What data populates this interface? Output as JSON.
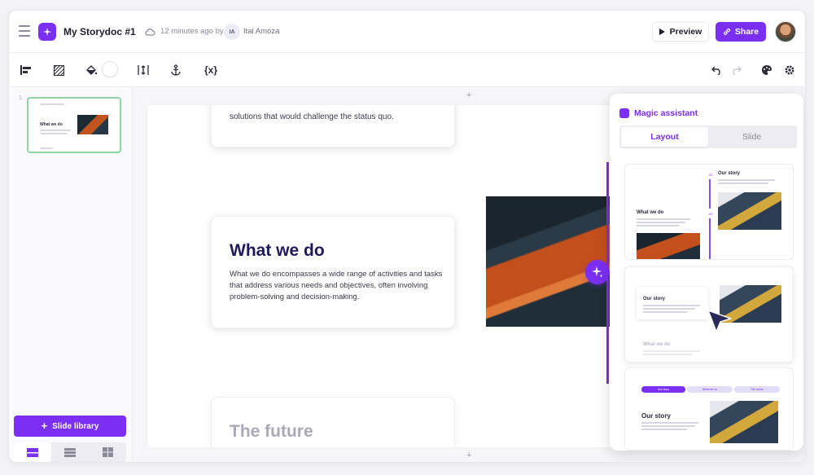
{
  "header": {
    "doc_title": "My Storydoc #1",
    "saved_status": "12 minutes ago by",
    "user_initials": "IA",
    "user_name": "Itai Amoza",
    "preview_label": "Preview",
    "share_label": "Share"
  },
  "toolbar": {
    "tools": [
      "align-left-icon",
      "pattern-icon",
      "fill-bucket-icon",
      "color-swatch",
      "height-adjust-icon",
      "anchor-icon",
      "variable-icon",
      "undo-icon",
      "redo-icon",
      "palette-icon",
      "settings-icon"
    ],
    "variable_label": "{x}"
  },
  "sidebar": {
    "slide_number": "1",
    "thumbnail_title": "What we do",
    "slide_library_label": "Slide library"
  },
  "slide": {
    "card1_text": "solutions that would challenge the status quo.",
    "card2_title": "What we do",
    "card2_text": "What we do encompasses a wide range of activities and tasks that address various needs and objectives, often involving problem-solving and decision-making.",
    "card3_title": "The future"
  },
  "assistant": {
    "title": "Magic assistant",
    "tabs": [
      {
        "label": "Layout",
        "active": true
      },
      {
        "label": "Slide",
        "active": false
      }
    ],
    "layouts": [
      {
        "title_a": "Our story",
        "title_b": "What we do",
        "num_a": "01",
        "num_b": "02"
      },
      {
        "title_a": "Our story",
        "title_b": "What we do"
      },
      {
        "title": "Our story",
        "pills": [
          "Our story",
          "What we do",
          "The future"
        ]
      }
    ]
  },
  "colors": {
    "accent": "#7b2ff2",
    "heading": "#1f1a5b",
    "thumb_border": "#8fd4a3"
  }
}
